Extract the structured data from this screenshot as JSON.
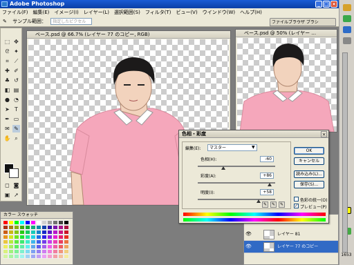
{
  "app": {
    "title": "Adobe Photoshop",
    "window_buttons": [
      "_",
      "□",
      "×"
    ]
  },
  "menu": [
    "ファイル(F)",
    "編集(E)",
    "イメージ(I)",
    "レイヤー(L)",
    "選択範囲(S)",
    "フィルタ(T)",
    "ビュー(V)",
    "ウインドウ(W)",
    "ヘルプ(H)"
  ],
  "options_bar": {
    "label": "サンプル範囲：",
    "value": "指定したピクセル"
  },
  "palette_well": {
    "label": "ファイルブラウザ ブラシ"
  },
  "documents": [
    {
      "title": "ベース.psd @ 66.7% (レイヤー 77 のコピー, RGB)"
    },
    {
      "title": "ベース.psd @ 50% (レイヤー ..."
    }
  ],
  "swatches_panel": {
    "tabs": "カラー スウォッチ"
  },
  "layers_panel": {
    "rows": [
      {
        "name": "レイヤー 81"
      },
      {
        "name": "レイヤー 77 のコピー"
      }
    ]
  },
  "dialog": {
    "title": "色相・彩度",
    "edit_label": "編集(E):",
    "edit_value": "マスター",
    "hue_label": "色相(H):",
    "hue_value": "-60",
    "saturation_label": "彩度(A):",
    "saturation_value": "+86",
    "lightness_label": "明度(I):",
    "lightness_value": "+58",
    "ok": "OK",
    "cancel": "キャンセル",
    "load": "読み込み(L)...",
    "save": "保存(S)...",
    "colorize": "色彩の統一(O)",
    "preview": "プレビュー(P)",
    "close": "×",
    "colorize_checked": "",
    "preview_checked": "✓",
    "sliders": {
      "hue": -60,
      "saturation": 86,
      "lightness": 58
    }
  },
  "status": {
    "clock": "1653"
  },
  "colors": {
    "titlebar": "#0b3fa6",
    "shirt": "#f5a7bb",
    "skin": "#f2d3bd",
    "hair": "#1c1a1a"
  }
}
